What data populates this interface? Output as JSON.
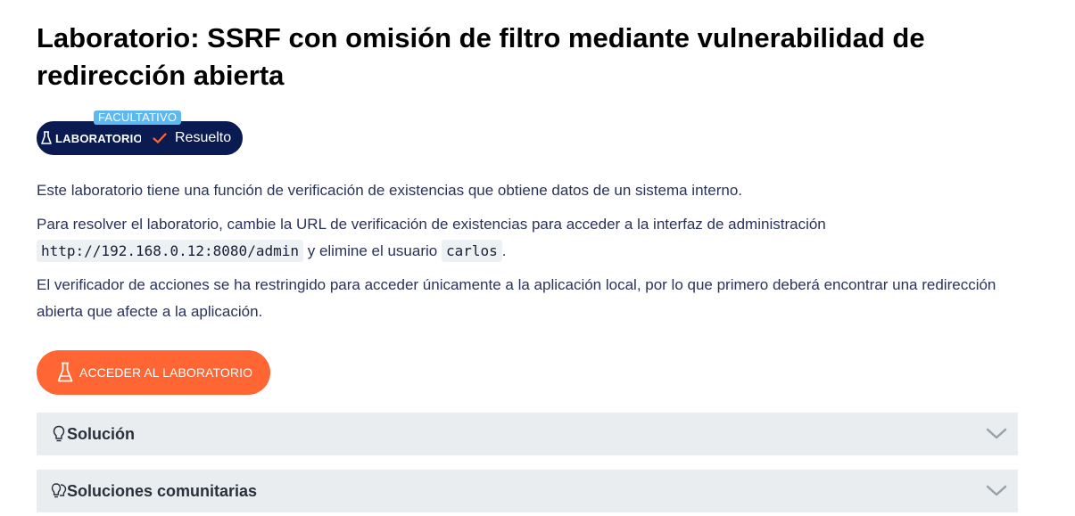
{
  "lab": {
    "title": "Laboratorio: SSRF con omisión de filtro mediante vulnerabilidad de redirección abierta",
    "badge": {
      "tag": "FACULTATIVO",
      "label": "LABORATORIO",
      "status": "Resuelto",
      "icon": "flask-icon",
      "status_icon": "check-icon"
    },
    "description": {
      "p1": "Este laboratorio tiene una función de verificación de existencias que obtiene datos de un sistema interno.",
      "p2_before": "Para resolver el laboratorio, cambie la URL de verificación de existencias para acceder a la interfaz de administración",
      "p2_code1": "http://192.168.0.12:8080/admin",
      "p2_middle": "y elimine el usuario",
      "p2_code2": "carlos",
      "p2_after": ".",
      "p3": "El verificador de acciones se ha restringido para acceder únicamente a la aplicación local, por lo que primero deberá encontrar una redirección abierta que afecte a la aplicación."
    },
    "access_button": {
      "label": "ACCEDER AL LABORATORIO",
      "icon": "flask-icon"
    },
    "accordions": [
      {
        "label": "Solución",
        "icon": "lightbulb-icon"
      },
      {
        "label": "Soluciones comunitarias",
        "icon": "lightbulbs-icon"
      }
    ]
  },
  "colors": {
    "badge_bg": "#0a1b51",
    "tag_bg": "#5cb8ee",
    "accent": "#ff6633",
    "accordion_bg": "#e9edf0",
    "text": "#2a3258"
  }
}
